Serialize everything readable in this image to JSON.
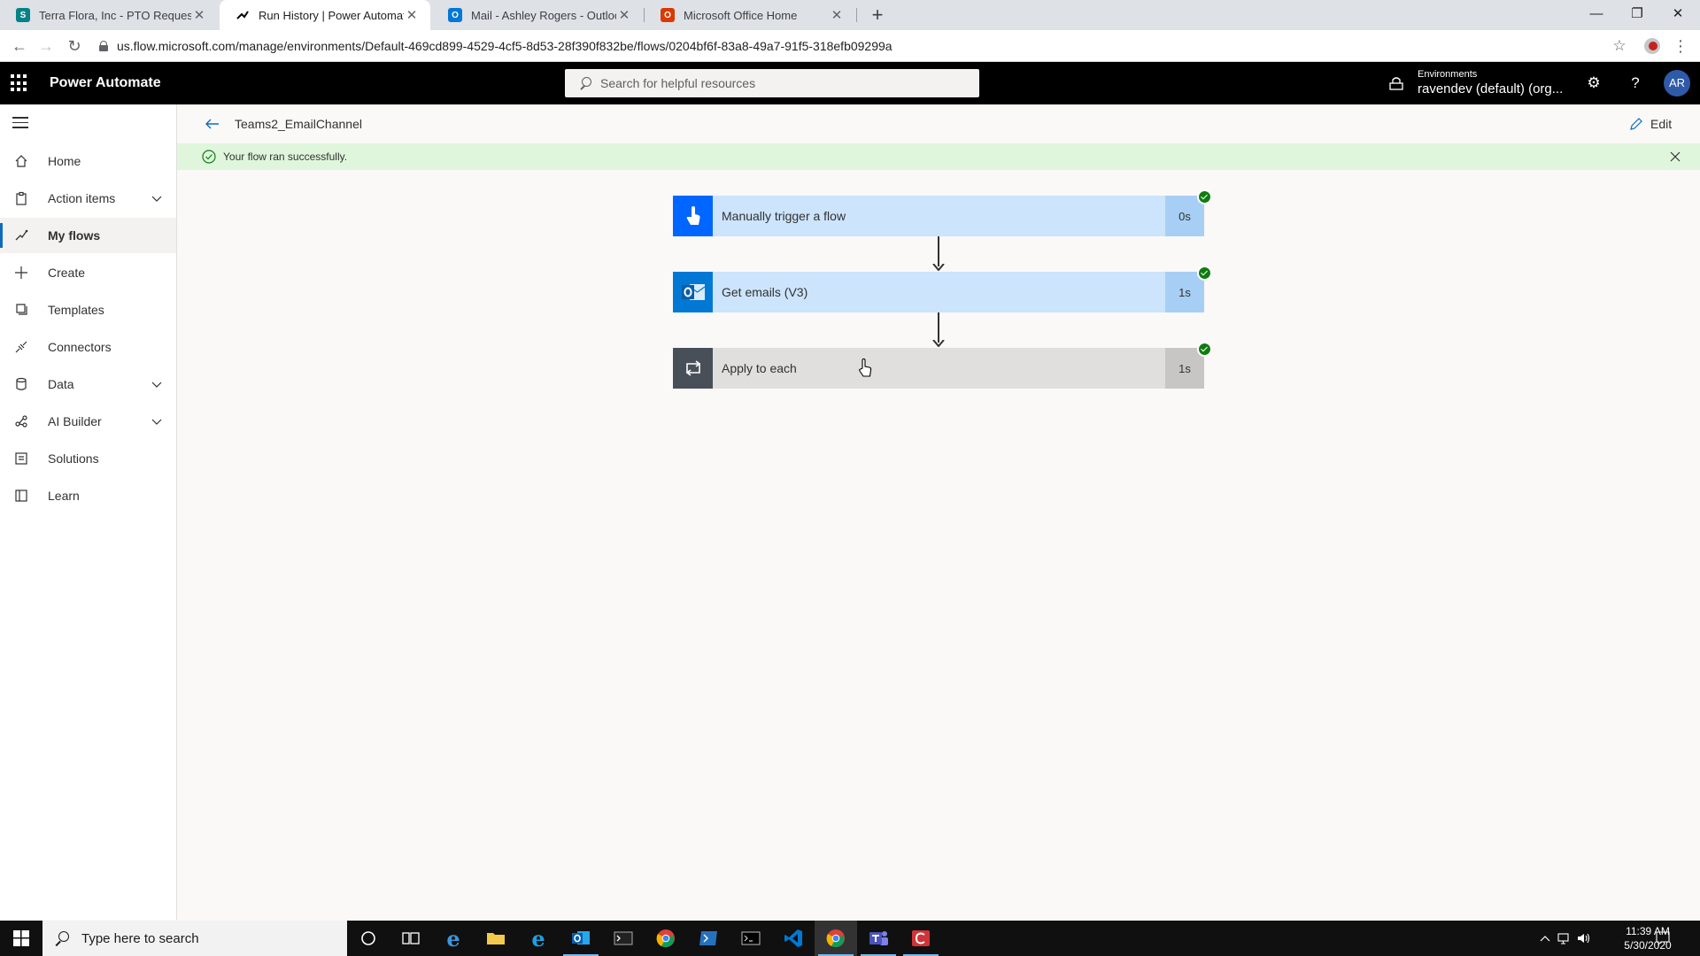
{
  "browser": {
    "tabs": [
      {
        "title": "Terra Flora, Inc - PTO Requests - ",
        "active": false,
        "favicon": "sharepoint-icon"
      },
      {
        "title": "Run History | Power Automate",
        "active": true,
        "favicon": "power-automate-icon"
      },
      {
        "title": "Mail - Ashley Rogers - Outlook",
        "active": false,
        "favicon": "outlook-icon"
      },
      {
        "title": "Microsoft Office Home",
        "active": false,
        "favicon": "office-icon"
      }
    ],
    "url": "us.flow.microsoft.com/manage/environments/Default-469cd899-4529-4cf5-8d53-28f390f832be/flows/0204bf6f-83a8-49a7-91f5-318efb09299a"
  },
  "header": {
    "app_name": "Power Automate",
    "search_placeholder": "Search for helpful resources",
    "environment_label": "Environments",
    "environment_value": "ravendev (default) (org...",
    "avatar_initials": "AR"
  },
  "nav": {
    "items": [
      {
        "label": "Home",
        "icon": "home-icon"
      },
      {
        "label": "Action items",
        "icon": "clipboard-icon",
        "expandable": true
      },
      {
        "label": "My flows",
        "icon": "flow-icon",
        "selected": true
      },
      {
        "label": "Create",
        "icon": "plus-icon"
      },
      {
        "label": "Templates",
        "icon": "templates-icon"
      },
      {
        "label": "Connectors",
        "icon": "connector-icon"
      },
      {
        "label": "Data",
        "icon": "database-icon",
        "expandable": true
      },
      {
        "label": "AI Builder",
        "icon": "ai-builder-icon",
        "expandable": true
      },
      {
        "label": "Solutions",
        "icon": "solutions-icon"
      },
      {
        "label": "Learn",
        "icon": "book-icon"
      }
    ]
  },
  "command_bar": {
    "flow_name": "Teams2_EmailChannel",
    "edit_label": "Edit"
  },
  "banner": {
    "message": "Your flow ran successfully."
  },
  "flow": {
    "steps": [
      {
        "label": "Manually trigger a flow",
        "duration": "0s",
        "status": "succeeded",
        "icon": "touch-trigger-icon"
      },
      {
        "label": "Get emails (V3)",
        "duration": "1s",
        "status": "succeeded",
        "icon": "outlook-icon"
      },
      {
        "label": "Apply to each",
        "duration": "1s",
        "status": "succeeded",
        "icon": "loop-icon"
      }
    ]
  },
  "taskbar": {
    "search_placeholder": "Type here to search",
    "time": "11:39 AM",
    "date": "5/30/2020"
  },
  "colors": {
    "accent": "#0f6cbd",
    "success": "#107c10",
    "banner_bg": "#dff6dd",
    "trigger_blue": "#0066ff",
    "step_blue_bg": "#cce4fc",
    "loop_gray": "#484f58"
  }
}
